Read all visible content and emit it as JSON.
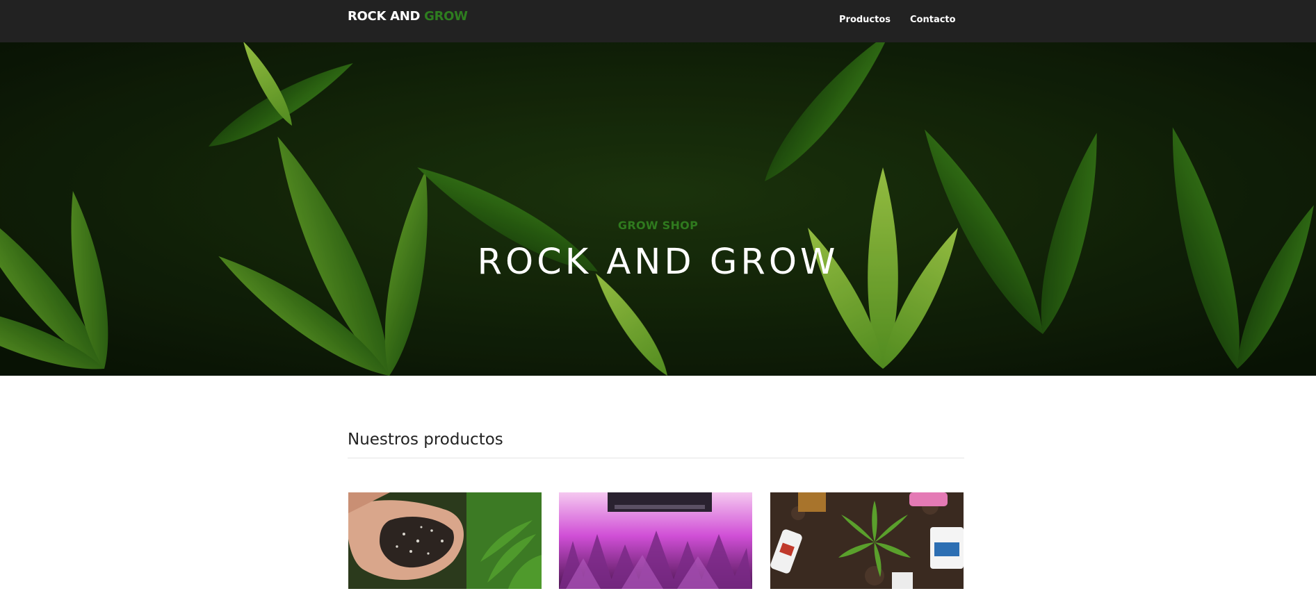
{
  "navbar": {
    "brand_part1": "ROCK AND ",
    "brand_part2": "GROW",
    "links": [
      {
        "label": "Productos"
      },
      {
        "label": "Contacto"
      }
    ],
    "background_color": "#222222",
    "accent_color": "#2e7d1f"
  },
  "hero": {
    "subtitle": "GROW SHOP",
    "title": "ROCK AND GROW",
    "background": "cannabis-leaves-image"
  },
  "products": {
    "heading": "Nuestros productos",
    "items": [
      {
        "image": "soil-in-hands-image"
      },
      {
        "image": "grow-light-plants-image"
      },
      {
        "image": "plant-with-fertilizers-image"
      }
    ]
  }
}
